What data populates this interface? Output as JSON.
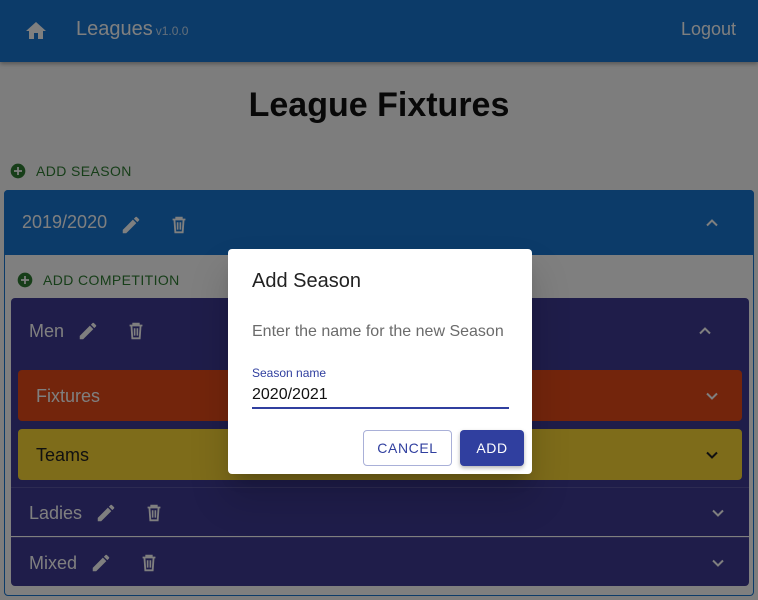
{
  "appbar": {
    "title": "Leagues",
    "version": "v1.0.0",
    "logout_label": "Logout"
  },
  "page": {
    "title": "League Fixtures"
  },
  "add_season_label": "ADD SEASON",
  "season": {
    "name": "2019/2020",
    "add_competition_label": "ADD COMPETITION",
    "competitions": [
      {
        "name": "Men",
        "expanded": true
      },
      {
        "name": "Ladies",
        "expanded": false
      },
      {
        "name": "Mixed",
        "expanded": false
      }
    ],
    "sections": [
      {
        "name": "Fixtures",
        "color": "#e64a19"
      },
      {
        "name": "Teams",
        "color": "#fdd835"
      }
    ]
  },
  "dialog": {
    "title": "Add Season",
    "text": "Enter the name for the new Season",
    "field_label": "Season name",
    "field_value": "2020/2021",
    "cancel_label": "CANCEL",
    "add_label": "ADD"
  },
  "colors": {
    "primary": "#1976d2",
    "competition": "#3f3a94",
    "success": "#2e7d32",
    "dialog_accent": "#303f9f"
  }
}
